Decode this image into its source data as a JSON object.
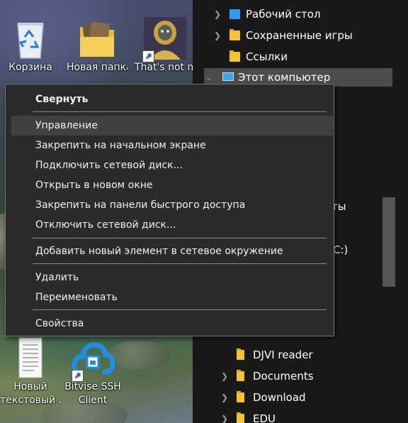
{
  "desktop": {
    "icons": [
      {
        "label": "Корзина",
        "icon": "recycle-bin-icon"
      },
      {
        "label": "Новая папка",
        "icon": "folder-icon"
      },
      {
        "label": "That's not m",
        "icon": "game-shortcut-icon"
      },
      {
        "label_line1": "Новый",
        "label_line2": "текстовый ...",
        "icon": "text-document-icon"
      },
      {
        "label_line1": "Bitvise SSH",
        "label_line2": "Client",
        "icon": "bitvise-icon"
      }
    ]
  },
  "nav": {
    "items": [
      {
        "label": "Рабочий стол",
        "icon": "desktop-folder-icon"
      },
      {
        "label": "Сохраненные игры",
        "icon": "saved-games-icon"
      },
      {
        "label": "Ссылки",
        "icon": "links-folder-icon"
      },
      {
        "label": "Этот компьютер",
        "icon": "this-pc-icon"
      },
      {
        "label": "ты",
        "icon": ""
      },
      {
        "label": "C:)",
        "icon": ""
      },
      {
        "label": "DJVI reader",
        "icon": "folder-icon"
      },
      {
        "label": "Documents",
        "icon": "folder-icon"
      },
      {
        "label": "Download",
        "icon": "folder-icon"
      },
      {
        "label": "EDU",
        "icon": "folder-icon"
      }
    ]
  },
  "context_menu": {
    "items": [
      {
        "label": "Свернуть",
        "bold": true
      },
      {
        "label": "Управление",
        "highlighted": true
      },
      {
        "label": "Закрепить на начальном экране"
      },
      {
        "label": "Подключить сетевой диск..."
      },
      {
        "label": "Открыть в новом окне"
      },
      {
        "label": "Закрепить на панели быстрого доступа"
      },
      {
        "label": "Отключить сетевой диск..."
      },
      {
        "label": "Добавить новый элемент в сетевое окружение"
      },
      {
        "label": "Удалить"
      },
      {
        "label": "Переименовать"
      },
      {
        "label": "Свойства"
      }
    ]
  },
  "colors": {
    "menu_bg": "#2b2b2b",
    "menu_highlight": "#414141",
    "nav_bg": "#191919",
    "nav_selected": "#4c4c4c",
    "folder_yellow": "#f2c433"
  }
}
